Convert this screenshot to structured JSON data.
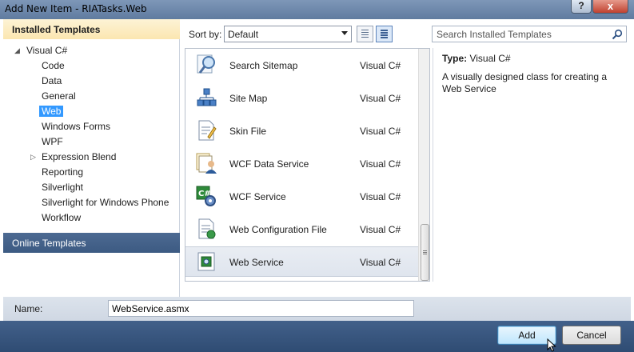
{
  "window": {
    "title": "Add New Item - RIATasks.Web",
    "help_label": "?",
    "close_label": "x"
  },
  "left_panel": {
    "installed_header": "Installed Templates",
    "tree": [
      {
        "label": "Visual C#",
        "expanded": true
      },
      {
        "label": "Code"
      },
      {
        "label": "Data"
      },
      {
        "label": "General"
      },
      {
        "label": "Web",
        "selected": true
      },
      {
        "label": "Windows Forms"
      },
      {
        "label": "WPF"
      },
      {
        "label": "Expression Blend",
        "collapsed": true
      },
      {
        "label": "Reporting"
      },
      {
        "label": "Silverlight"
      },
      {
        "label": "Silverlight for Windows Phone"
      },
      {
        "label": "Workflow"
      }
    ],
    "online_header": "Online Templates"
  },
  "toolbar": {
    "sort_label": "Sort by:",
    "sort_value": "Default",
    "search_placeholder": "Search Installed Templates"
  },
  "templates": [
    {
      "name": "Search Sitemap",
      "lang": "Visual C#",
      "icon": "magnifier-icon"
    },
    {
      "name": "Site Map",
      "lang": "Visual C#",
      "icon": "sitemap-icon"
    },
    {
      "name": "Skin File",
      "lang": "Visual C#",
      "icon": "skin-file-icon"
    },
    {
      "name": "WCF Data Service",
      "lang": "Visual C#",
      "icon": "data-service-icon"
    },
    {
      "name": "WCF Service",
      "lang": "Visual C#",
      "icon": "wcf-service-icon"
    },
    {
      "name": "Web Configuration File",
      "lang": "Visual C#",
      "icon": "config-file-icon"
    },
    {
      "name": "Web Service",
      "lang": "Visual C#",
      "icon": "web-service-icon",
      "selected": true
    }
  ],
  "description": {
    "type_label": "Type:",
    "type_value": "Visual C#",
    "text": "A visually designed class for creating a Web Service"
  },
  "name_field": {
    "label": "Name:",
    "value": "WebService.asmx"
  },
  "buttons": {
    "add": "Add",
    "cancel": "Cancel"
  },
  "colors": {
    "selection": "#3399ff",
    "header_gold": "#fbe6b0",
    "frame_blue": "#3c5a82"
  }
}
